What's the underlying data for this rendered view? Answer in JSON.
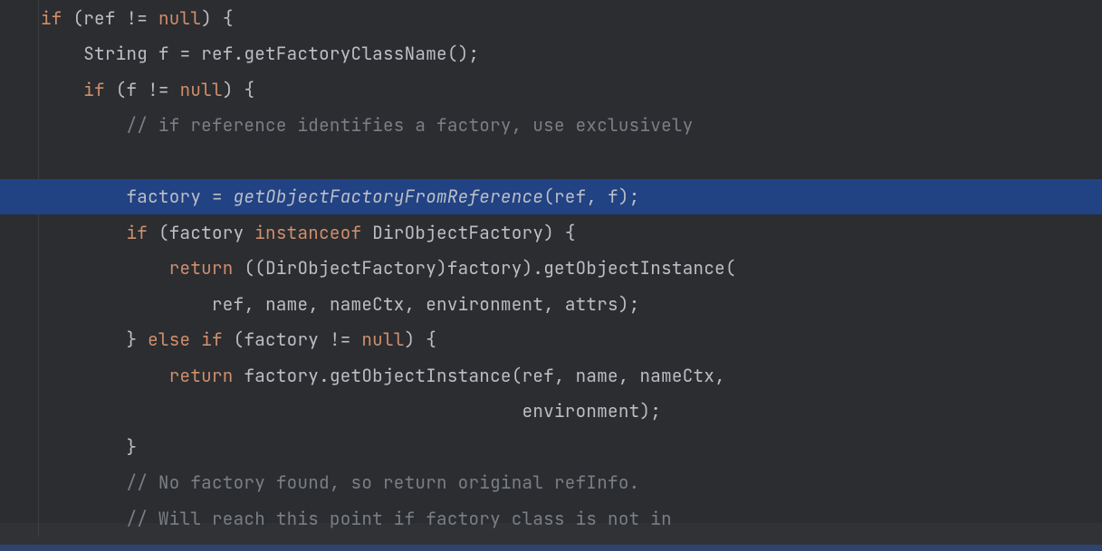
{
  "tokens": {
    "if": "if",
    "else": "else",
    "return": "return",
    "null": "null",
    "instanceof": "instanceof"
  },
  "idents": {
    "ref": "ref",
    "String": "String",
    "f": "f",
    "factory": "factory",
    "DirObjectFactory": "DirObjectFactory",
    "name": "name",
    "nameCtx": "nameCtx",
    "environment": "environment",
    "attrs": "attrs"
  },
  "calls": {
    "getFactoryClassName": "getFactoryClassName",
    "getObjectFactoryFromReference": "getObjectFactoryFromReference",
    "getObjectInstance": "getObjectInstance"
  },
  "comments": {
    "c1": "// if reference identifies a factory, use exclusively",
    "c2": "// No factory found, so return original refInfo.",
    "c3": "// Will reach this point if factory class is not in"
  },
  "punct": {
    "lpar": "(",
    "rpar": ")",
    "lbrace": "{",
    "rbrace": "}",
    "semi": ";",
    "comma": ",",
    "dot": ".",
    "neq": "!=",
    "eq": "="
  }
}
